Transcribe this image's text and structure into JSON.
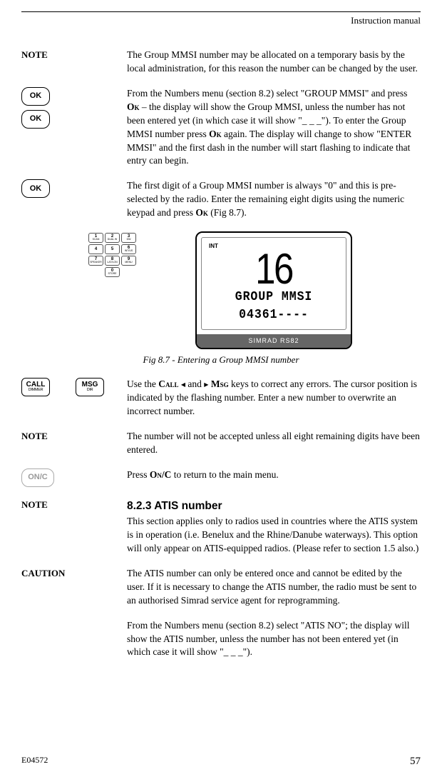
{
  "header": {
    "title": "Instruction manual"
  },
  "note_label": "NOTE",
  "caution_label": "CAUTION",
  "para1": "The Group MMSI number may be allocated on a temporary basis by the local administration, for this reason the number can be changed by the user.",
  "para2_a": "From the Numbers menu (section 8.2) select \"GROUP MMSI\" and press ",
  "para2_ok1": "Ok",
  "para2_b": " – the display will show the Group MMSI, unless the number has not been entered yet (in which case it will show \"_ _ _\"). To enter the Group MMSI number press ",
  "para2_ok2": "Ok",
  "para2_c": " again. The display will change to show \"ENTER MMSI\" and the first dash in the number will start flashing to indicate that entry can begin.",
  "para3_a": "The first digit of a Group MMSI number is always \"0\" and this is pre-selected by the radio. Enter the remaining eight digits using the numeric keypad and press ",
  "para3_ok": "Ok",
  "para3_b": " (Fig 8.7).",
  "lcd": {
    "int": "INT",
    "channel": "16",
    "line1": "GROUP MMSI",
    "line2": "04361----",
    "footer": "SIMRAD RS82"
  },
  "fig_caption": "Fig 8.7 - Entering a Group MMSI number",
  "para4_a": "Use the ",
  "para4_call": "Call",
  "para4_b": " and ",
  "para4_msg": "Msg",
  "para4_c": " keys to correct any errors. The cursor position is indicated by the flashing number. Enter a new number to overwrite an incorrect number.",
  "para5": "The number will not be accepted unless all eight remaining digits have been entered.",
  "para6_a": "Press ",
  "para6_onc": "On/C",
  "para6_b": " to return to the main menu.",
  "section_heading": "8.2.3  ATIS number",
  "para7": "This section applies only to radios used in countries where the ATIS system is in operation (i.e. Benelux and the Rhine/Danube waterways). This option will only appear on ATIS-equipped radios. (Please refer to section 1.5 also.)",
  "para8": "The ATIS number can only be entered once and cannot be edited by the user. If it is necessary to change the ATIS number, the radio must be sent to an authorised Simrad service agent for reprogramming.",
  "para9": "From the Numbers menu (section 8.2) select \"ATIS NO\"; the display will show the ATIS number, unless the number has not been entered yet (in which case it will show \"_ _ _\").",
  "buttons": {
    "ok": "OK",
    "call_top": "CALL",
    "call_sub": "DIMMER",
    "msg_top": "MSG",
    "msg_sub": "DIR",
    "onc": "ON/C"
  },
  "keypad": [
    {
      "n": "1",
      "l": "SCAN"
    },
    {
      "n": "2",
      "l": "DUAL W"
    },
    {
      "n": "3",
      "l": "DW"
    },
    {
      "n": "4",
      "l": ""
    },
    {
      "n": "5",
      "l": ""
    },
    {
      "n": "6",
      "l": "INT/US"
    },
    {
      "n": "7",
      "l": "SPEAKER"
    },
    {
      "n": "8",
      "l": "LAT/LON"
    },
    {
      "n": "9",
      "l": "MENU"
    },
    {
      "n": "",
      "l": ""
    },
    {
      "n": "0",
      "l": "STORE"
    },
    {
      "n": "",
      "l": ""
    }
  ],
  "footer": {
    "code": "E04572",
    "page": "57"
  }
}
